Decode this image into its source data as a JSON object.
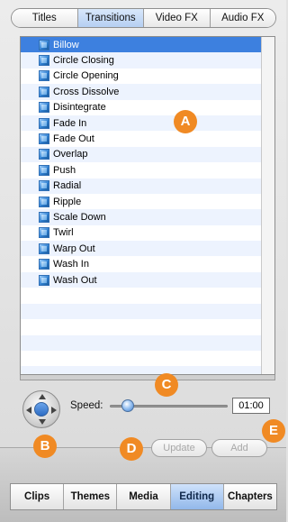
{
  "tabs": [
    "Titles",
    "Transitions",
    "Video FX",
    "Audio FX"
  ],
  "selected_tab": "Transitions",
  "transitions": [
    "Billow",
    "Circle Closing",
    "Circle Opening",
    "Cross Dissolve",
    "Disintegrate",
    "Fade In",
    "Fade Out",
    "Overlap",
    "Push",
    "Radial",
    "Ripple",
    "Scale Down",
    "Twirl",
    "Warp Out",
    "Wash In",
    "Wash Out"
  ],
  "selected_transition": "Billow",
  "callouts": {
    "a": "A",
    "b": "B",
    "c": "C",
    "d": "D",
    "e": "E"
  },
  "speed": {
    "label": "Speed:",
    "value": "01:00",
    "slider_fraction": 0.15
  },
  "buttons": {
    "update": "Update",
    "add": "Add"
  },
  "bottom_nav": [
    "Clips",
    "Themes",
    "Media",
    "Editing",
    "Chapters"
  ],
  "selected_nav": "Editing",
  "colors": {
    "selection": "#3d80df",
    "callout": "#f08a24"
  }
}
